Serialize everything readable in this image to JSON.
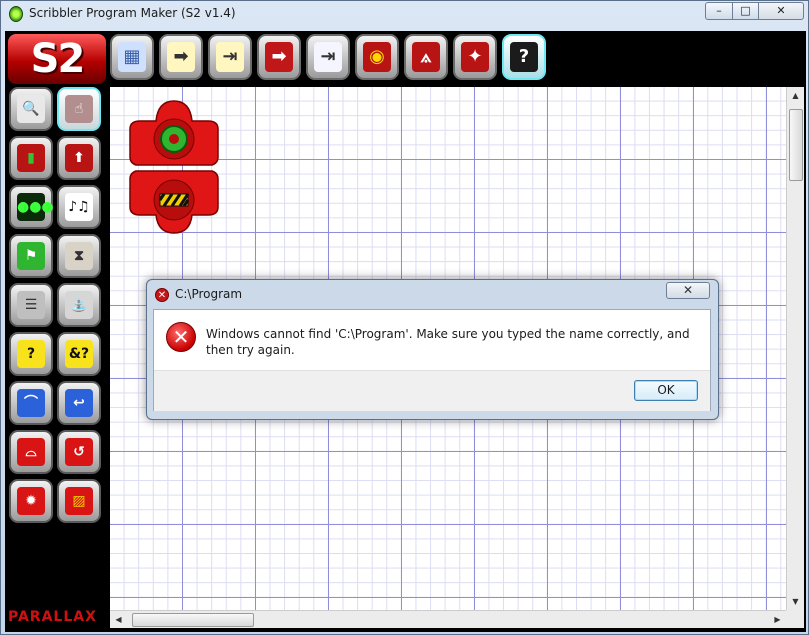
{
  "window": {
    "title": "Scribbler Program Maker (S2 v1.4)",
    "icon": "scribbler-app-icon",
    "controls": {
      "minimize": "–",
      "maximize": "□",
      "close": "✕"
    }
  },
  "logo": {
    "text": "S2"
  },
  "toolbar": {
    "buttons": [
      {
        "name": "grid-icon",
        "glyph": "▦",
        "color": "#3a5ea8",
        "bg": "#cfe0ff"
      },
      {
        "name": "open-file-icon",
        "glyph": "➡",
        "color": "#333333",
        "bg": "#fff6c0"
      },
      {
        "name": "import-file-icon",
        "glyph": "⇥",
        "color": "#333333",
        "bg": "#fff6c0"
      },
      {
        "name": "export-file-icon",
        "glyph": "➡",
        "color": "#ffffff",
        "bg": "#c01818"
      },
      {
        "name": "save-file-icon",
        "glyph": "⇥",
        "color": "#333333",
        "bg": "#f5f5ff"
      },
      {
        "name": "robot-angel-icon",
        "glyph": "◉",
        "color": "#ffd700",
        "bg": "#b81414"
      },
      {
        "name": "compass-icon",
        "glyph": "⟑",
        "color": "#ffffff",
        "bg": "#b81414"
      },
      {
        "name": "robot-run-icon",
        "glyph": "✦",
        "color": "#ffffff",
        "bg": "#b81414"
      },
      {
        "name": "help-icon",
        "glyph": "?",
        "color": "#ffffff",
        "bg": "#1b1b1b"
      }
    ]
  },
  "palette": {
    "buttons": [
      {
        "name": "zoom-icon",
        "glyph": "🔍",
        "color": "#222222",
        "bg": "#e8e8e8"
      },
      {
        "name": "hand-pointer-icon",
        "glyph": "☝",
        "color": "#ffffff",
        "bg": "#b28e8e"
      },
      {
        "name": "green-flag-block-icon",
        "glyph": "▮",
        "color": "#34c234",
        "bg": "#b81414"
      },
      {
        "name": "robot-back-icon",
        "glyph": "⬆",
        "color": "#ffffff",
        "bg": "#b81414"
      },
      {
        "name": "led-lights-icon",
        "glyph": "●●●",
        "color": "#3bff3b",
        "bg": "#0a2a0a"
      },
      {
        "name": "music-notes-icon",
        "glyph": "♪♫",
        "color": "#111111",
        "bg": "#ffffff"
      },
      {
        "name": "flag-arrow-icon",
        "glyph": "⚑",
        "color": "#ffffff",
        "bg": "#2fb52f"
      },
      {
        "name": "hourglass-icon",
        "glyph": "⧗",
        "color": "#333333",
        "bg": "#d9d2c6"
      },
      {
        "name": "sensor-read-icon",
        "glyph": "☰",
        "color": "#333333",
        "bg": "#bfbfbf"
      },
      {
        "name": "fountain-icon",
        "glyph": "⛲",
        "color": "#333333",
        "bg": "#d6d6d6"
      },
      {
        "name": "condition-question-icon",
        "glyph": "?",
        "color": "#111111",
        "bg": "#f7e21c"
      },
      {
        "name": "and-condition-icon",
        "glyph": "&?",
        "color": "#111111",
        "bg": "#f7e21c"
      },
      {
        "name": "loop-start-icon",
        "glyph": "⌒",
        "color": "#ffffff",
        "bg": "#2b62d9"
      },
      {
        "name": "loop-end-icon",
        "glyph": "↩",
        "color": "#ffffff",
        "bg": "#2b62d9"
      },
      {
        "name": "subroutine-cap-icon",
        "glyph": "⌓",
        "color": "#ffffff",
        "bg": "#d91414"
      },
      {
        "name": "goto-arrow-icon",
        "glyph": "↺",
        "color": "#ffffff",
        "bg": "#d91414"
      },
      {
        "name": "gear-start-icon",
        "glyph": "✹",
        "color": "#ffffff",
        "bg": "#d91414"
      },
      {
        "name": "stop-hazard-icon",
        "glyph": "▨",
        "color": "#f2d000",
        "bg": "#d91414"
      }
    ]
  },
  "brand": {
    "text": "PARALLAX"
  },
  "canvas_blocks": [
    {
      "name": "start-gear-block",
      "shape": "start"
    },
    {
      "name": "end-hazard-block",
      "shape": "end"
    }
  ],
  "dialog": {
    "title": "C:\\Program",
    "close": "✕",
    "message": "Windows cannot find 'C:\\Program'. Make sure you typed the name correctly, and then try again.",
    "ok": "OK",
    "icon_glyph": "✕"
  },
  "scrollbars": {
    "up": "▲",
    "down": "▼",
    "left": "◀",
    "right": "▶"
  }
}
